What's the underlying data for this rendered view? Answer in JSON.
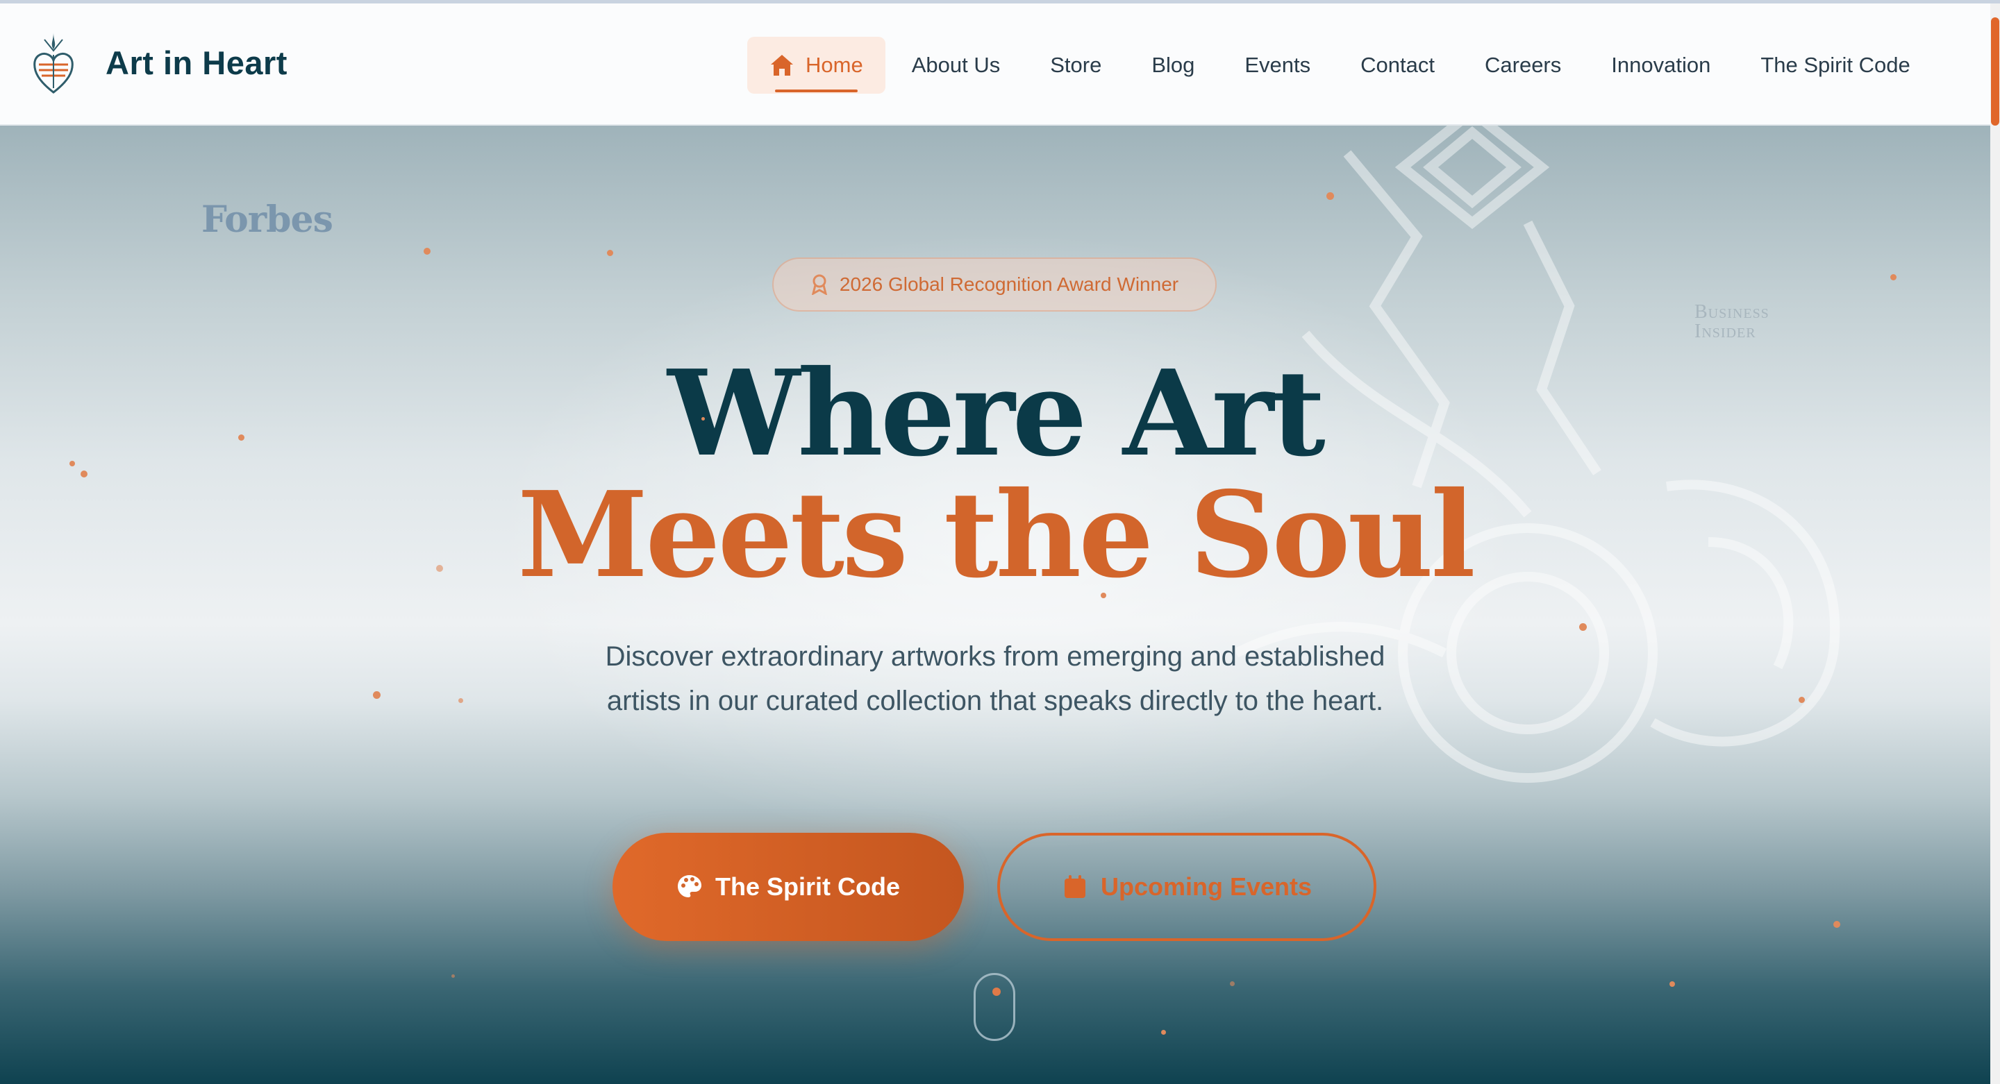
{
  "brand": {
    "name": "Art in Heart",
    "logo_icon": "heart-emblem-logo"
  },
  "nav": {
    "items": [
      {
        "label": "Home",
        "icon": "home-icon",
        "active": true
      },
      {
        "label": "About Us"
      },
      {
        "label": "Store"
      },
      {
        "label": "Blog"
      },
      {
        "label": "Events"
      },
      {
        "label": "Contact"
      },
      {
        "label": "Careers"
      },
      {
        "label": "Innovation"
      },
      {
        "label": "The Spirit Code"
      }
    ]
  },
  "press": {
    "forbes": "Forbes",
    "business_insider_line1": "Business",
    "business_insider_line2": "Insider"
  },
  "hero": {
    "badge": "2026 Global Recognition Award Winner",
    "title_line1": "Where Art",
    "title_line2": "Meets the Soul",
    "subtitle": "Discover extraordinary artworks from emerging and established artists in our curated collection that speaks directly to the heart.",
    "primary_button": "The Spirit Code",
    "secondary_button": "Upcoming Events"
  },
  "colors": {
    "accent": "#d9652a",
    "heading": "#0b3a48",
    "text": "#3d5563",
    "hero_bottom": "#0f4250"
  }
}
